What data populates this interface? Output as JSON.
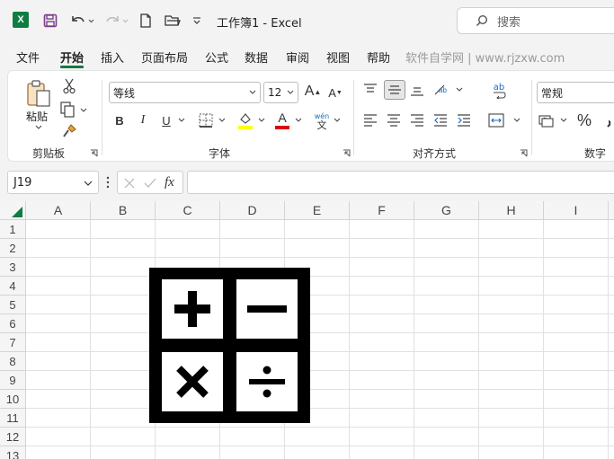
{
  "app": {
    "title": "工作簿1  -  Excel",
    "logo_letter": "X",
    "brand_color": "#107c41"
  },
  "search": {
    "placeholder": "搜索"
  },
  "tabs": [
    {
      "label": "文件"
    },
    {
      "label": "开始",
      "active": true
    },
    {
      "label": "插入"
    },
    {
      "label": "页面布局"
    },
    {
      "label": "公式"
    },
    {
      "label": "数据"
    },
    {
      "label": "审阅"
    },
    {
      "label": "视图"
    },
    {
      "label": "帮助"
    }
  ],
  "watermark": "软件自学网 | www.rjzxw.com",
  "ribbon": {
    "clipboard": {
      "paste_label": "粘贴",
      "group_label": "剪贴板"
    },
    "font": {
      "font_name": "等线",
      "font_size": "12",
      "group_label": "字体",
      "bold": "B",
      "italic": "I",
      "underline": "U",
      "grow": "A",
      "shrink": "A",
      "font_color_letter": "A",
      "phonetic_top": "wén",
      "phonetic_bottom": "文",
      "highlight_color": "#ffff00",
      "font_color": "#e00000"
    },
    "alignment": {
      "group_label": "对齐方式",
      "wrap_label": "ab"
    },
    "number": {
      "format": "常规",
      "group_label": "数字",
      "percent": "%"
    }
  },
  "formula_bar": {
    "name_box": "J19",
    "fx_label": "fx",
    "formula": ""
  },
  "sheet": {
    "columns": [
      "A",
      "B",
      "C",
      "D",
      "E",
      "F",
      "G",
      "H",
      "I"
    ],
    "rows": [
      "1",
      "2",
      "3",
      "4",
      "5",
      "6",
      "7",
      "8",
      "9",
      "10",
      "11",
      "12",
      "13"
    ]
  },
  "icons": {
    "calculator": "calculator-icon"
  }
}
